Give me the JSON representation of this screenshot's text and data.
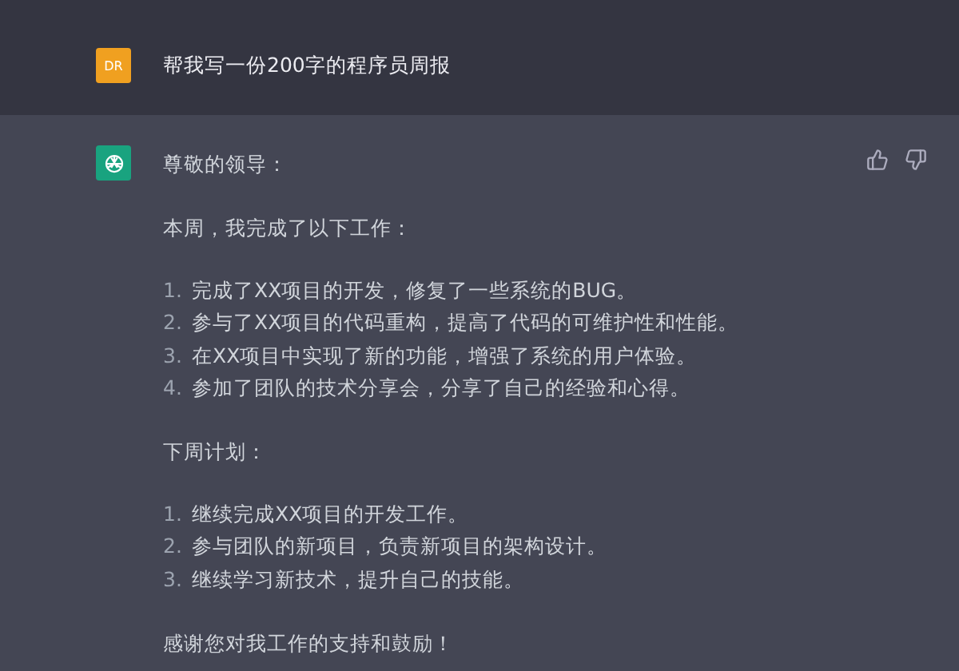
{
  "user_message": {
    "avatar": "DR",
    "text": "帮我写一份200字的程序员周报"
  },
  "assistant_message": {
    "blocks": [
      {
        "kind": "paragraph",
        "text": "尊敬的领导："
      },
      {
        "kind": "paragraph",
        "text": "本周，我完成了以下工作："
      },
      {
        "kind": "list",
        "items": [
          {
            "number": "1.",
            "text": "完成了XX项目的开发，修复了一些系统的BUG。"
          },
          {
            "number": "2.",
            "text": "参与了XX项目的代码重构，提高了代码的可维护性和性能。"
          },
          {
            "number": "3.",
            "text": "在XX项目中实现了新的功能，增强了系统的用户体验。"
          },
          {
            "number": "4.",
            "text": "参加了团队的技术分享会，分享了自己的经验和心得。"
          }
        ]
      },
      {
        "kind": "paragraph",
        "text": "下周计划："
      },
      {
        "kind": "list",
        "items": [
          {
            "number": "1.",
            "text": "继续完成XX项目的开发工作。"
          },
          {
            "number": "2.",
            "text": "参与团队的新项目，负责新项目的架构设计。"
          },
          {
            "number": "3.",
            "text": "继续学习新技术，提升自己的技能。"
          }
        ]
      },
      {
        "kind": "paragraph",
        "text": "感谢您对我工作的支持和鼓励！"
      }
    ]
  }
}
